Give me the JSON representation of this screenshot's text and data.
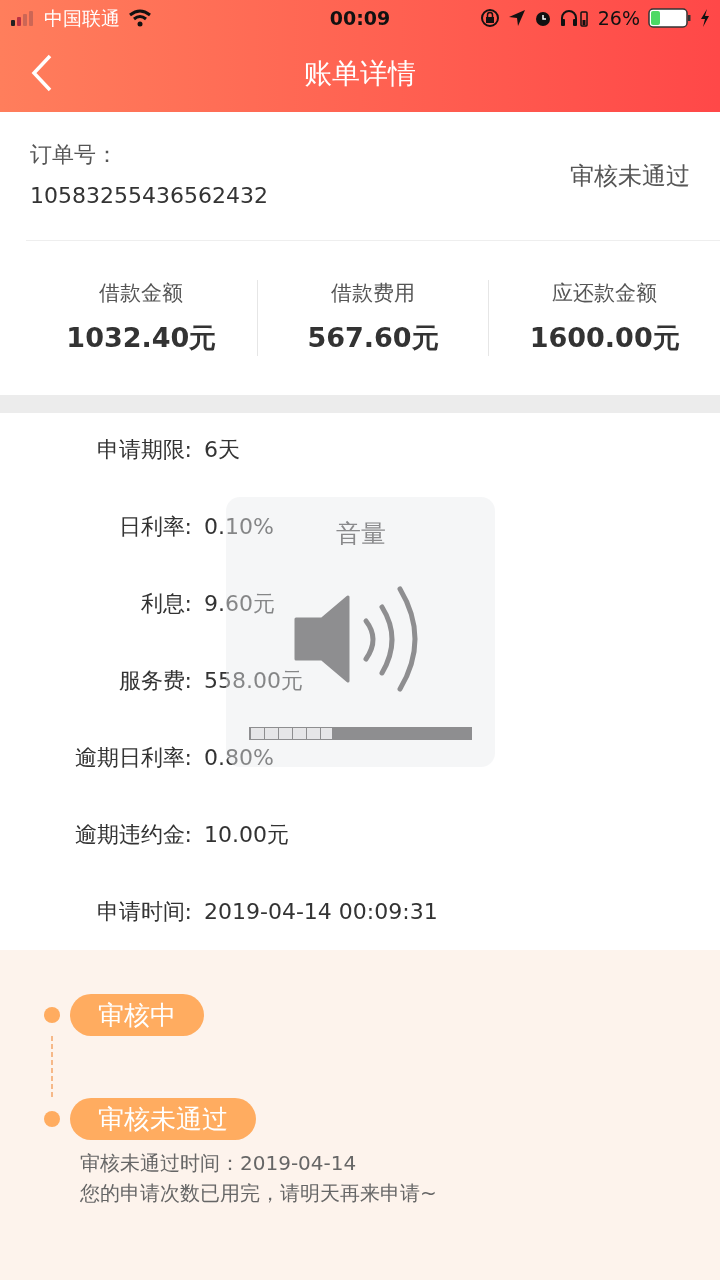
{
  "status_bar": {
    "carrier": "中国联通",
    "time": "00:09",
    "battery_text": "26%",
    "battery": {
      "level": 0.26
    }
  },
  "header": {
    "title": "账单详情"
  },
  "order": {
    "label": "订单号：",
    "number": "10583255436562432",
    "status": "审核未通过"
  },
  "amounts": [
    {
      "label": "借款金额",
      "value": "1032.40元"
    },
    {
      "label": "借款费用",
      "value": "567.60元"
    },
    {
      "label": "应还款金额",
      "value": "1600.00元"
    }
  ],
  "details": [
    {
      "label": "申请期限:",
      "value": "6天"
    },
    {
      "label": "日利率:",
      "value": "0.10%"
    },
    {
      "label": "利息:",
      "value": "9.60元"
    },
    {
      "label": "服务费:",
      "value": "558.00元"
    },
    {
      "label": "逾期日利率:",
      "value": "0.80%"
    },
    {
      "label": "逾期违约金:",
      "value": "10.00元"
    },
    {
      "label": "申请时间:",
      "value": "2019-04-14 00:09:31"
    }
  ],
  "timeline": [
    {
      "label": "审核中"
    },
    {
      "label": "审核未通过",
      "notes": [
        "审核未通过时间：2019-04-14",
        "您的申请次数已用完，请明天再来申请~"
      ]
    }
  ],
  "volume_hud": {
    "title": "音量",
    "level": 0.375
  }
}
